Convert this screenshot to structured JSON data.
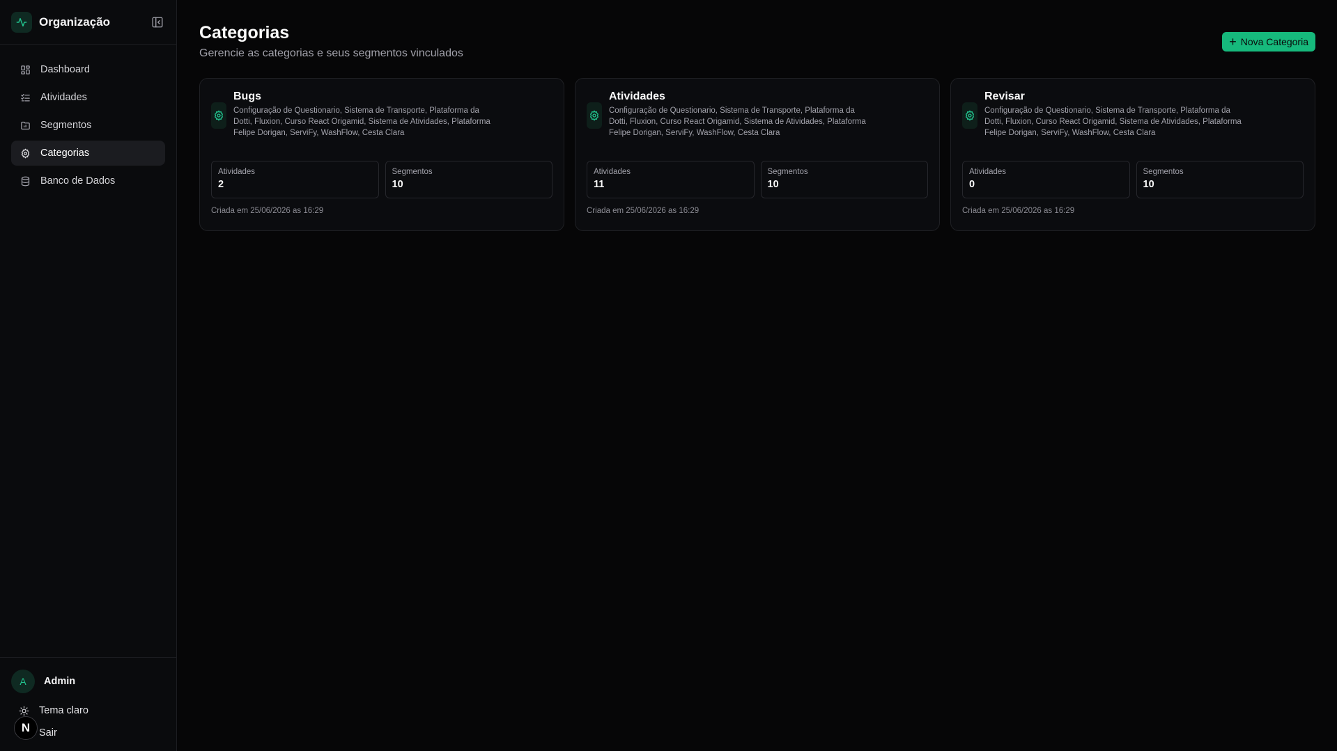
{
  "sidebar": {
    "org_name": "Organização",
    "items": [
      {
        "label": "Dashboard",
        "icon": "grid-icon"
      },
      {
        "label": "Atividades",
        "icon": "list-check-icon"
      },
      {
        "label": "Segmentos",
        "icon": "folder-chart-icon"
      },
      {
        "label": "Categorias",
        "icon": "gear-icon",
        "active": true
      },
      {
        "label": "Banco de Dados",
        "icon": "database-icon"
      }
    ],
    "footer": {
      "avatar_initial": "A",
      "user_name": "Admin",
      "theme_label": "Tema claro",
      "logout_label": "Sair",
      "badge_letter": "N"
    }
  },
  "header": {
    "title": "Categorias",
    "subtitle": "Gerencie as categorias e seus segmentos vinculados",
    "new_button_label": "Nova Categoria"
  },
  "cards": [
    {
      "title": "Bugs",
      "description": "Configuração de Questionario, Sistema de Transporte, Plataforma da Dotti, Fluxion, Curso React Origamid, Sistema de Atividades, Plataforma Felipe Dorigan, ServiFy, WashFlow, Cesta Clara",
      "activities_label": "Atividades",
      "activities_value": "2",
      "segments_label": "Segmentos",
      "segments_value": "10",
      "created": "Criada em 25/06/2026 as 16:29"
    },
    {
      "title": "Atividades",
      "description": "Configuração de Questionario, Sistema de Transporte, Plataforma da Dotti, Fluxion, Curso React Origamid, Sistema de Atividades, Plataforma Felipe Dorigan, ServiFy, WashFlow, Cesta Clara",
      "activities_label": "Atividades",
      "activities_value": "11",
      "segments_label": "Segmentos",
      "segments_value": "10",
      "created": "Criada em 25/06/2026 as 16:29"
    },
    {
      "title": "Revisar",
      "description": "Configuração de Questionario, Sistema de Transporte, Plataforma da Dotti, Fluxion, Curso React Origamid, Sistema de Atividades, Plataforma Felipe Dorigan, ServiFy, WashFlow, Cesta Clara",
      "activities_label": "Atividades",
      "activities_value": "0",
      "segments_label": "Segmentos",
      "segments_value": "10",
      "created": "Criada em 25/06/2026 as 16:29"
    }
  ],
  "colors": {
    "accent": "#16b97c",
    "background": "#060607",
    "sidebar": "#0a0b0d"
  }
}
